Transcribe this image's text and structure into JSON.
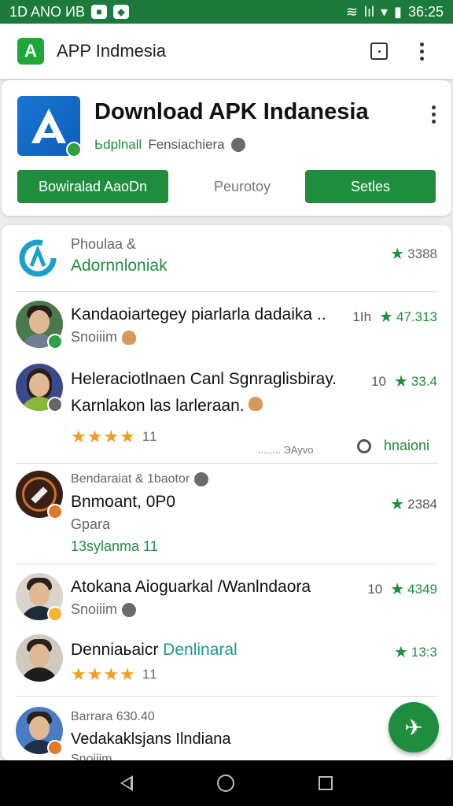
{
  "status_bar": {
    "left_text": "1D ANO ИB",
    "time": "36:25",
    "signal_text": "lıl"
  },
  "app_bar": {
    "logo_letter": "A",
    "title": "APP Indmesia"
  },
  "hero": {
    "title": "Download APK Indanesia",
    "subtitle_green": "Ьdplnall",
    "subtitle_grey": "Fensiachiera",
    "button_primary": "Bowiralad AaoDn",
    "button_text": "Peurotoy",
    "button_secondary": "Setlеs"
  },
  "list": {
    "header": {
      "title": "Phoulaa &",
      "subtitle": "Adornnloniak",
      "score": "3388"
    },
    "item1": {
      "title": "Kandaoiartegey piarlarla dadaika ..",
      "subtitle": "Snoiiim",
      "count": "1Ih",
      "score": "47.313"
    },
    "item2": {
      "title_line1": "Heleraciotlnaen Canl Sgnraglisbiray.",
      "title_line2": "Karnlakon las larleraan.",
      "count": "10",
      "score": "33.4",
      "stars": "★★★★",
      "rating_count": "11",
      "meta": "........ ЭAyvo",
      "action": "hnaioni"
    },
    "item3": {
      "overline": "Bendaraiat & 1baotor",
      "title": "Bnmoant, 0P0",
      "subtitle": "Gpara",
      "extra": "13sylanma 11",
      "score": "2384"
    },
    "item4": {
      "title": "Atokana Aioguarkal /Wanlndaora",
      "subtitle": "Snoiiim",
      "count": "10",
      "score": "4349"
    },
    "item5": {
      "title": "Denniaьaicr",
      "title_green": "Denlinaral",
      "stars": "★★★★",
      "rating_count": "11",
      "score": "13:3"
    },
    "item6": {
      "overline": "Barrara 630.40",
      "title": "Vedakaklsjans Ilndiana",
      "subtitle": "Snoiiim"
    }
  },
  "colors": {
    "primary_green": "#1e8e3e",
    "status_green": "#1b7a3c",
    "star_orange": "#f29d1e",
    "logo_blue": "#1976d2"
  }
}
